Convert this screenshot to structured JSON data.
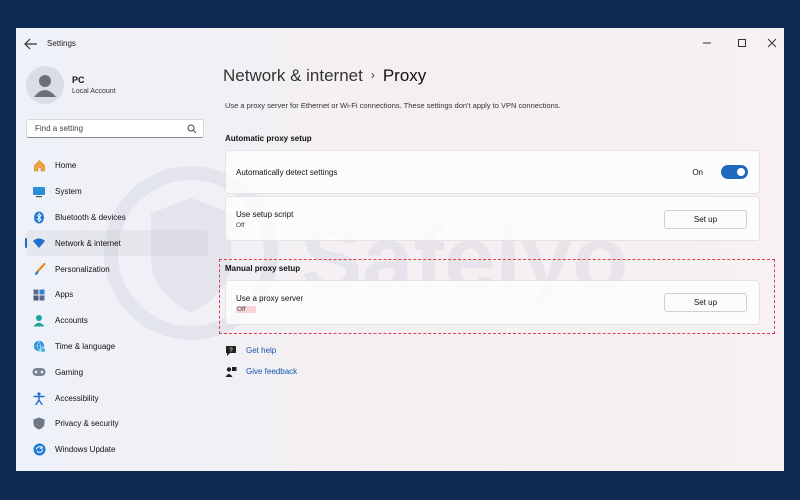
{
  "window": {
    "title": "Settings"
  },
  "user": {
    "name": "PC",
    "account_type": "Local Account"
  },
  "search": {
    "placeholder": "Find a setting"
  },
  "sidebar": {
    "items": [
      {
        "label": "Home",
        "icon": "home-icon",
        "active": false
      },
      {
        "label": "System",
        "icon": "system-icon",
        "active": false
      },
      {
        "label": "Bluetooth & devices",
        "icon": "bluetooth-icon",
        "active": false
      },
      {
        "label": "Network & internet",
        "icon": "wifi-icon",
        "active": true
      },
      {
        "label": "Personalization",
        "icon": "brush-icon",
        "active": false
      },
      {
        "label": "Apps",
        "icon": "apps-icon",
        "active": false
      },
      {
        "label": "Accounts",
        "icon": "accounts-icon",
        "active": false
      },
      {
        "label": "Time & language",
        "icon": "globe-clock-icon",
        "active": false
      },
      {
        "label": "Gaming",
        "icon": "gamepad-icon",
        "active": false
      },
      {
        "label": "Accessibility",
        "icon": "accessibility-icon",
        "active": false
      },
      {
        "label": "Privacy & security",
        "icon": "shield-icon",
        "active": false
      },
      {
        "label": "Windows Update",
        "icon": "update-icon",
        "active": false
      }
    ]
  },
  "breadcrumb": {
    "parent": "Network & internet",
    "separator": "›",
    "current": "Proxy"
  },
  "main": {
    "description": "Use a proxy server for Ethernet or Wi-Fi connections. These settings don't apply to VPN connections.",
    "automatic": {
      "heading": "Automatic proxy setup",
      "detect": {
        "label": "Automatically detect settings",
        "state": "On"
      },
      "script": {
        "label": "Use setup script",
        "state": "Off",
        "button": "Set up"
      }
    },
    "manual": {
      "heading": "Manual proxy setup",
      "proxy": {
        "label": "Use a proxy server",
        "state": "Off",
        "button": "Set up"
      }
    },
    "links": {
      "help": "Get help",
      "feedback": "Give feedback"
    }
  },
  "colors": {
    "accent": "#1f68c0",
    "highlight": "#d9414d",
    "background": "#0f2a52"
  },
  "watermark": "Safelyo"
}
